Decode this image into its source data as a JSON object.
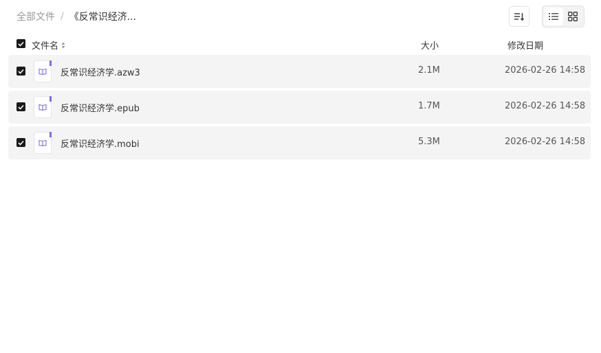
{
  "breadcrumb": {
    "root": "全部文件",
    "separator": "/",
    "current": "《反常识经济..."
  },
  "toolbar": {
    "sort_icon": "sort-icon",
    "view_list_icon": "list-view-icon",
    "view_grid_icon": "grid-view-icon",
    "active_view": "list"
  },
  "table": {
    "headers": {
      "name": "文件名",
      "size": "大小",
      "date": "修改日期"
    },
    "select_all_checked": true,
    "rows": [
      {
        "checked": true,
        "icon": "ebook-icon",
        "name": "反常识经济学.azw3",
        "size": "2.1M",
        "date": "2026-02-26 14:58"
      },
      {
        "checked": true,
        "icon": "ebook-icon",
        "name": "反常识经济学.epub",
        "size": "1.7M",
        "date": "2026-02-26 14:58"
      },
      {
        "checked": true,
        "icon": "ebook-icon",
        "name": "反常识经济学.mobi",
        "size": "5.3M",
        "date": "2026-02-26 14:58"
      }
    ]
  },
  "colors": {
    "accent": "#7c6cf0",
    "row_bg": "#f4f4f4",
    "checkbox": "#1a1a1a"
  }
}
